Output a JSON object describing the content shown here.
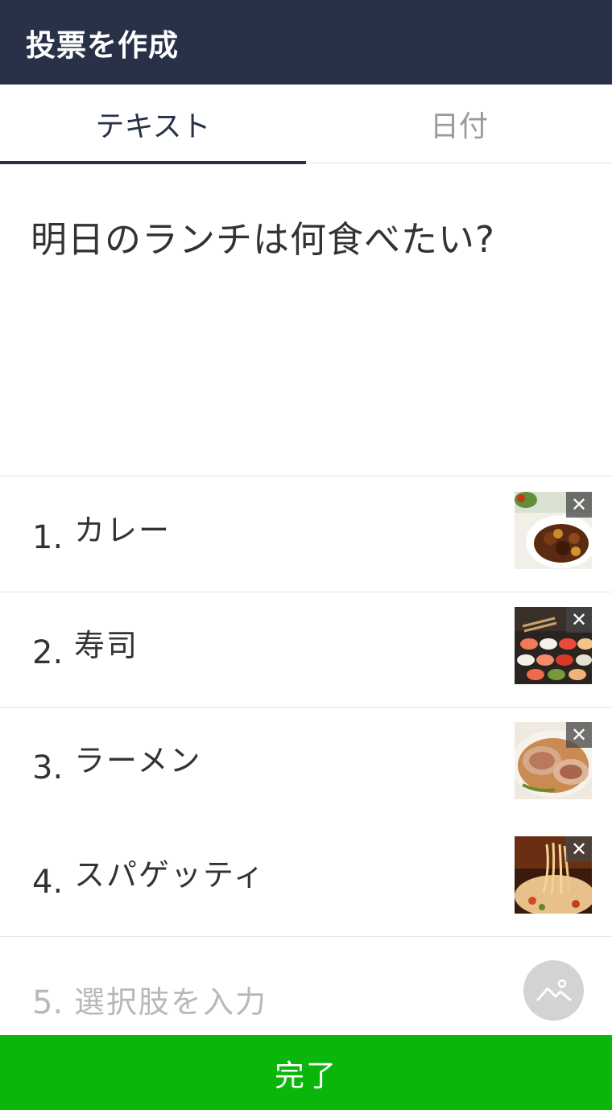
{
  "header": {
    "title": "投票を作成"
  },
  "tabs": [
    {
      "label": "テキスト",
      "active": true
    },
    {
      "label": "日付",
      "active": false
    }
  ],
  "question": {
    "text": "明日のランチは何食べたい?"
  },
  "options": [
    {
      "number": "1.",
      "label": "カレー",
      "image": "curry-photo"
    },
    {
      "number": "2.",
      "label": "寿司",
      "image": "sushi-photo"
    },
    {
      "number": "3.",
      "label": "ラーメン",
      "image": "ramen-photo"
    },
    {
      "number": "4.",
      "label": "スパゲッティ",
      "image": "spaghetti-photo"
    },
    {
      "number": "5.",
      "placeholder": "選択肢を入力"
    }
  ],
  "icons": {
    "remove": "close-icon",
    "add_image": "image-icon"
  },
  "footer": {
    "done_label": "完了"
  },
  "colors": {
    "header_bg": "#283148",
    "accent_green": "#0ab60a",
    "tab_active": "#283148",
    "placeholder_text": "#b8b8b8"
  }
}
